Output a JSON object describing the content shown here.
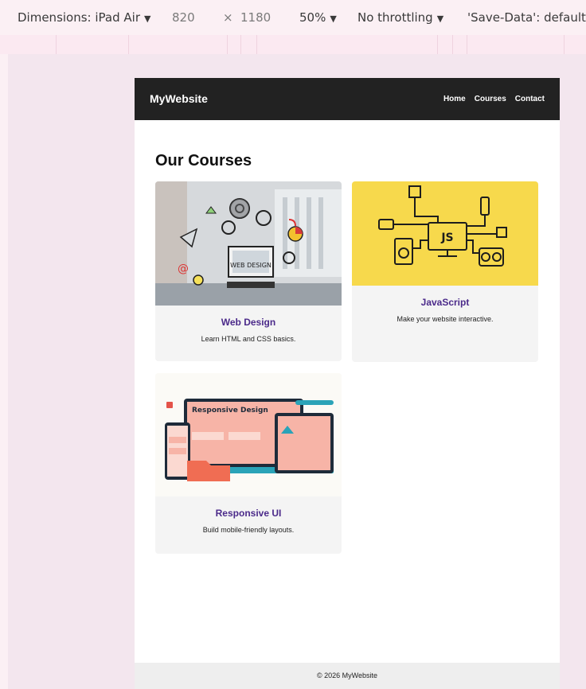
{
  "devtools": {
    "device": "Dimensions: iPad Air",
    "width": "820",
    "times": "×",
    "height": "1180",
    "zoom": "50%",
    "throttling": "No throttling",
    "save_data": "'Save-Data': default",
    "caret": "▼"
  },
  "site": {
    "brand": "MyWebsite",
    "nav": [
      "Home",
      "Courses",
      "Contact"
    ],
    "heading": "Our Courses",
    "courses": [
      {
        "title": "Web Design",
        "description": "Learn HTML and CSS basics."
      },
      {
        "title": "JavaScript",
        "description": "Make your website interactive."
      },
      {
        "title": "Responsive UI",
        "description": "Build mobile-friendly layouts."
      }
    ],
    "js_badge": "JS",
    "responsive_art_title": "Responsive Design",
    "footer": "© 2026 MyWebsite"
  },
  "colors": {
    "navbar": "#222222",
    "accent_title": "#4b2a8a",
    "js_yellow": "#f7d94c",
    "card_bg": "#f4f4f4"
  }
}
